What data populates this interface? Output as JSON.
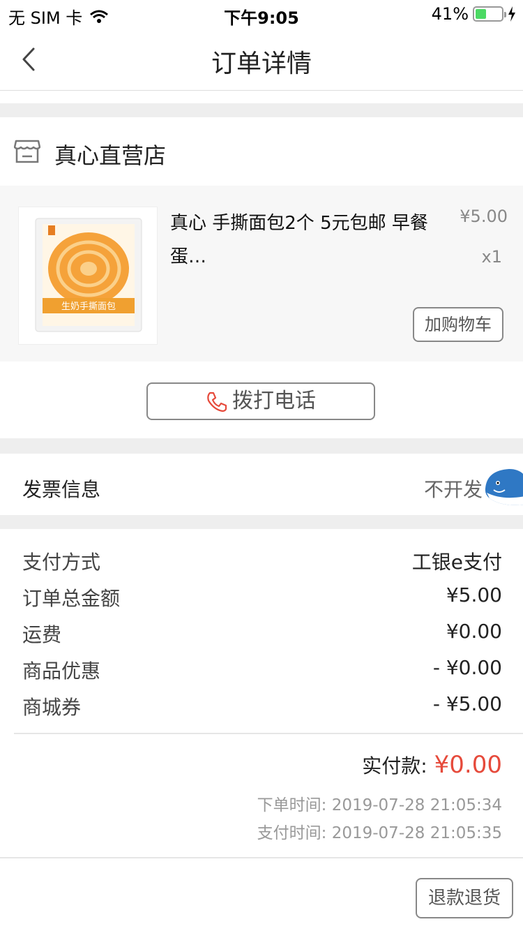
{
  "status_bar": {
    "carrier": "无 SIM 卡",
    "time": "下午9:05",
    "battery_percent": "41%",
    "battery_level": 0.41
  },
  "nav": {
    "title": "订单详情"
  },
  "shop": {
    "name": "真心直营店"
  },
  "product": {
    "title": "真心 手撕面包2个 5元包邮 早餐蛋…",
    "price": "¥5.00",
    "quantity": "x1",
    "add_cart_label": "加购物车",
    "thumbnail_text": "生奶手撕面包"
  },
  "call": {
    "label": "拨打电话"
  },
  "invoice": {
    "label": "发票信息",
    "value": "不开发"
  },
  "payment": {
    "rows": [
      {
        "label": "支付方式",
        "value": "工银e支付"
      },
      {
        "label": "订单总金额",
        "value": "¥5.00"
      },
      {
        "label": "运费",
        "value": "¥0.00"
      },
      {
        "label": "商品优惠",
        "value": "- ¥0.00"
      },
      {
        "label": "商城券",
        "value": "- ¥5.00"
      }
    ],
    "paid_label": "实付款:",
    "paid_amount": "¥0.00",
    "order_time": "下单时间: 2019-07-28 21:05:34",
    "pay_time": "支付时间: 2019-07-28 21:05:35"
  },
  "footer": {
    "refund_label": "退款退货"
  },
  "colors": {
    "accent_red": "#e64a3b",
    "battery_green": "#4cd964",
    "section_gap": "#eeeeee"
  },
  "icons": {
    "back": "chevron-left-icon",
    "shop": "store-icon",
    "phone": "phone-icon",
    "whale": "whale-float-icon",
    "wifi": "wifi-icon",
    "battery": "battery-icon",
    "charging": "bolt-icon"
  }
}
